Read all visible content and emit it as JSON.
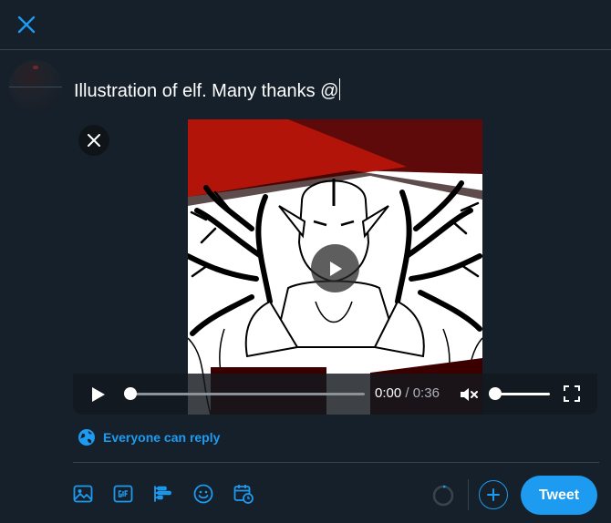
{
  "composer": {
    "text": "Illustration of elf. Many thanks @"
  },
  "header": {
    "close_icon": "close-icon"
  },
  "video": {
    "current_time": "0:00",
    "separator": " / ",
    "duration": "0:36",
    "progress_fraction": 0.02,
    "volume_fraction": 0.0,
    "icons": [
      "play-icon",
      "mute-icon",
      "fullscreen-icon",
      "remove-media-icon"
    ]
  },
  "reply_setting": {
    "label": "Everyone can reply",
    "icon": "globe-icon"
  },
  "toolbar": {
    "icons": [
      "image-icon",
      "gif-icon",
      "poll-icon",
      "emoji-icon",
      "schedule-icon"
    ],
    "add_icon": "plus-icon",
    "tweet_label": "Tweet"
  },
  "colors": {
    "background": "#15202b",
    "accent": "#1d9bf0",
    "divider": "#38444d"
  }
}
